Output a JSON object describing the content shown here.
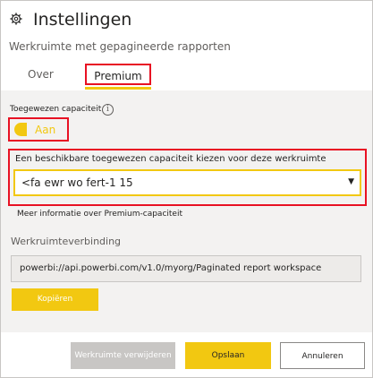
{
  "panel": {
    "title": "Instellingen",
    "subtitle": "Werkruimte met gepagineerde rapporten",
    "icon": "gear-icon"
  },
  "tabs": [
    {
      "label": "Over",
      "active": false
    },
    {
      "label": "Premium",
      "active": true
    }
  ],
  "capacity": {
    "label": "Toegewezen capaciteit",
    "info_icon": "info-icon",
    "info_glyph": "i",
    "toggle_label": "Aan",
    "toggle_on": true
  },
  "select": {
    "label": "Een beschikbare toegewezen capaciteit kiezen voor deze werkruimte",
    "value": "<fa ewr wo fert-1 15",
    "arrow_glyph": "▼"
  },
  "more_info": "Meer informatie over Premium-capaciteit",
  "connection": {
    "label": "Werkruimteverbinding",
    "value": "powerbi://api.powerbi.com/v1.0/myorg/Paginated report workspace",
    "copy_label": "Kopiëren"
  },
  "footer": {
    "delete_label": "Werkruimte verwijderen",
    "save_label": "Opslaan",
    "cancel_label": "Annuleren"
  },
  "colors": {
    "accent": "#f2c811",
    "highlight": "#e81123",
    "body_bg": "#f3f2f1"
  }
}
